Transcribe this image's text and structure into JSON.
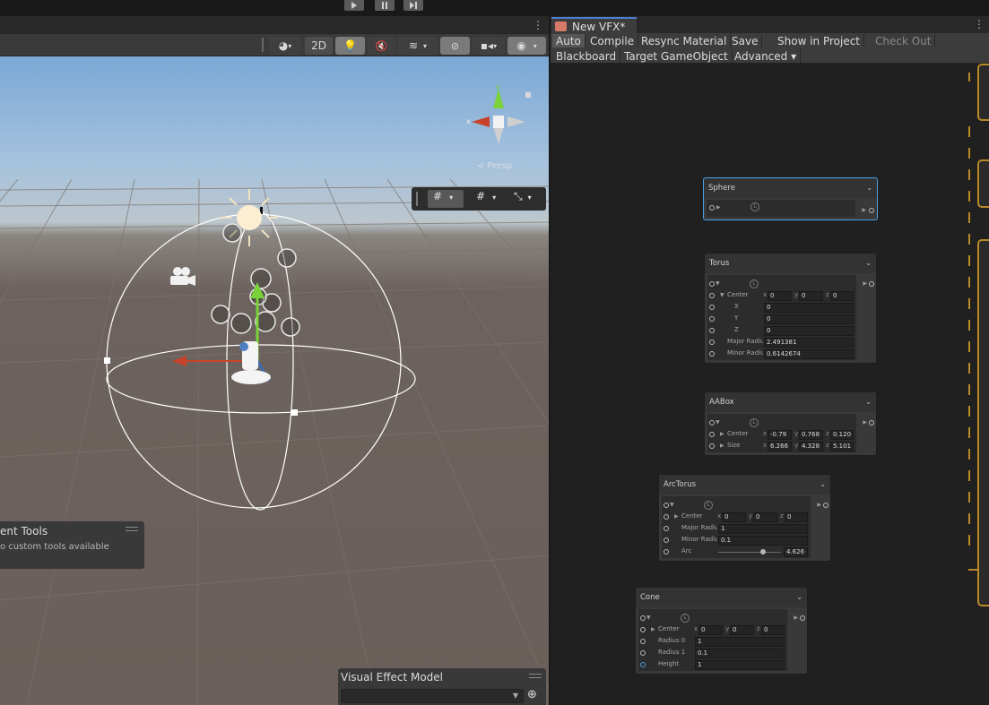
{
  "playbar": {
    "play": "play-icon",
    "pause": "pause-icon",
    "step": "step-icon"
  },
  "scene_toolbar": {
    "mode_2d": "2D"
  },
  "overlays": {
    "tools_title": "ent Tools",
    "tools_text": "o custom tools available",
    "vem_title": "Visual Effect Model",
    "gizmo_label": "< Persp",
    "gizmo_x": "x",
    "gizmo_y": "y"
  },
  "vfx": {
    "tab_title": "New VFX*",
    "toolbar1": [
      "Auto",
      "Compile",
      "Resync Material",
      "Save",
      "Show in Project",
      "Check Out"
    ],
    "toolbar2": [
      "Blackboard",
      "Target GameObject",
      "Advanced ▾"
    ],
    "nodes": {
      "sphere": {
        "title": "Sphere"
      },
      "torus": {
        "title": "Torus",
        "center_label": "Center",
        "cx": "0",
        "cy": "0",
        "cz": "0",
        "x_label": "X",
        "y_label": "Y",
        "z_label": "Z",
        "x_val": "0",
        "y_val": "0",
        "z_val": "0",
        "major_label": "Major Radiu",
        "major_val": "2.491381",
        "minor_label": "Minor Radiu",
        "minor_val": "0.6142674"
      },
      "aabox": {
        "title": "AABox",
        "center_label": "Center",
        "cx": "-0.79",
        "cy": "0.768",
        "cz": "0.120",
        "size_label": "Size",
        "sx": "6.266",
        "sy": "4.328",
        "sz": "5.101"
      },
      "arctorus": {
        "title": "ArcTorus",
        "center_label": "Center",
        "cx": "0",
        "cy": "0",
        "cz": "0",
        "major_label": "Major Radiu",
        "major_val": "1",
        "minor_label": "Minor Radiu",
        "minor_val": "0.1",
        "arc_label": "Arc",
        "arc_val": "4.626"
      },
      "cone": {
        "title": "Cone",
        "center_label": "Center",
        "cx": "0",
        "cy": "0",
        "cz": "0",
        "r0_label": "Radius 0",
        "r0_val": "1",
        "r1_label": "Radius 1",
        "r1_val": "0.1",
        "h_label": "Height",
        "h_val": "1"
      }
    }
  },
  "axis_letters": {
    "x": "x",
    "y": "y",
    "z": "z"
  },
  "colors": {
    "accent": "#4c7fd0",
    "selection": "#4aa2e8",
    "orange": "#b98a28",
    "gizmo_x": "#c8432a",
    "gizmo_y": "#7ad23a"
  }
}
